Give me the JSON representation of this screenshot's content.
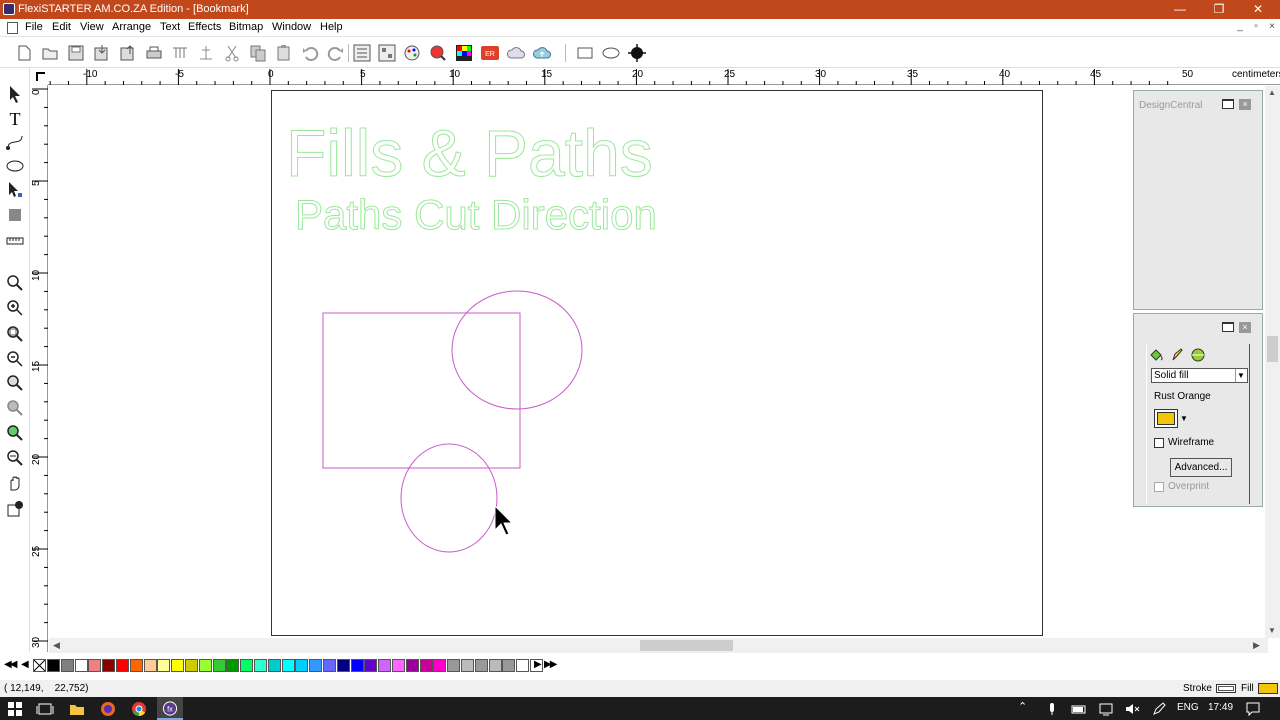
{
  "window": {
    "title": "FlexiSTARTER AM.CO.ZA Edition - [Bookmark]",
    "minimize": "—",
    "maximize": "❐",
    "close": "✕"
  },
  "menu": {
    "items": [
      "File",
      "Edit",
      "View",
      "Arrange",
      "Text",
      "Effects",
      "Bitmap",
      "Window",
      "Help"
    ],
    "mdi": {
      "minimize": "_",
      "restore": "▫",
      "close": "×"
    }
  },
  "ruler": {
    "unit": "centimeters",
    "h_labels": [
      "-10",
      "-5",
      "0",
      "5",
      "10",
      "15",
      "20",
      "25",
      "30",
      "35",
      "40",
      "45",
      "50"
    ],
    "v_labels": [
      "0",
      "5",
      "10",
      "15",
      "20",
      "25",
      "30"
    ]
  },
  "canvas": {
    "heading": "Fills & Paths",
    "subheading": "Paths Cut Direction",
    "colors": {
      "heading_stroke": "#9be89b",
      "shape_stroke": "#c85ac8"
    }
  },
  "design_central": {
    "title": "DesignCentral"
  },
  "fill_panel": {
    "fill_type": "Solid fill",
    "color_name": "Rust Orange",
    "swatch_color": "#f2c50a",
    "wireframe_label": "Wireframe",
    "advanced_label": "Advanced...",
    "overprint_label": "Overprint"
  },
  "palette": {
    "colors": [
      "#000000",
      "#808080",
      "#ffffff",
      "#f08080",
      "#8b0000",
      "#ff0000",
      "#ff6600",
      "#ffcc99",
      "#ffff99",
      "#ffff00",
      "#cccc00",
      "#99ff33",
      "#33cc33",
      "#009900",
      "#00ff66",
      "#33ffcc",
      "#00cccc",
      "#00ffff",
      "#00ccff",
      "#3399ff",
      "#6666ff",
      "#000080",
      "#0000ff",
      "#6600cc",
      "#cc66ff",
      "#ff66ff",
      "#990099",
      "#cc0099",
      "#ff00cc",
      "#999999",
      "#bbbbbb",
      "#999999",
      "#bbbbbb",
      "#999999",
      "#ffffff",
      "#ffffff"
    ]
  },
  "status": {
    "coords": "( 12,149,    22,752)",
    "stroke_label": "Stroke",
    "fill_label": "Fill",
    "fill_color": "#f2c50a"
  },
  "taskbar": {
    "language": "ENG",
    "time": "17:49"
  }
}
